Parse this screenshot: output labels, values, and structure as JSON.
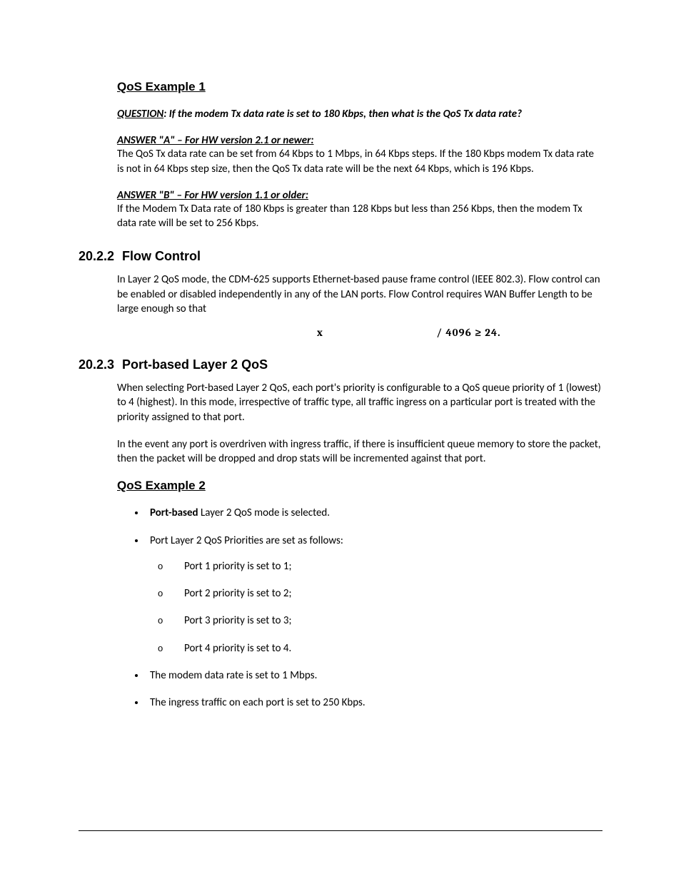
{
  "example1": {
    "title": "QoS Example 1",
    "question_label": "QUESTION",
    "question_rest": ": If the modem Tx data rate is set to 180 Kbps, then what is the QoS Tx data rate?",
    "answer_a_hdr": "ANSWER \"A\" – For HW version 2.1 or newer:",
    "answer_a_body": "The QoS Tx data rate can be set from 64 Kbps to 1 Mbps, in 64 Kbps steps. If the 180 Kbps modem Tx data rate is not in 64 Kbps step size, then the QoS Tx data rate will be the next 64 Kbps, which is 196 Kbps.",
    "answer_b_hdr": "ANSWER \"B\" – For HW version 1.1 or older:",
    "answer_b_body": "If the Modem Tx Data rate of 180 Kbps is greater than 128 Kbps but less than 256 Kbps, then the modem Tx data rate will be set to 256 Kbps."
  },
  "section_flow": {
    "num": "20.2.2",
    "title": "Flow Control",
    "body": "In Layer 2 QoS mode, the CDM-625 supports Ethernet-based pause frame control (IEEE 802.3). Flow control can be enabled or disabled independently in any of the LAN ports. Flow Control requires WAN Buffer Length to be large enough so that",
    "formula_x": "x",
    "formula_rest": "/ 4096 ≥ 24."
  },
  "section_port": {
    "num": "20.2.3",
    "title": "Port-based Layer 2 QoS",
    "p1": "When selecting Port-based Layer 2 QoS, each port's priority is configurable to a QoS queue priority of 1 (lowest) to 4 (highest). In this mode, irrespective of traffic type, all traffic ingress on a particular port is treated with the priority assigned to that port.",
    "p2": "In the event any port is overdriven with ingress traffic, if there is insufficient queue memory to store the packet, then the packet will be dropped and drop stats will be incremented against that port."
  },
  "example2": {
    "title": "QoS Example 2",
    "b1_bold": "Port-based",
    "b1_rest": " Layer 2 QoS mode is selected.",
    "b2": "Port Layer 2 QoS Priorities are set as follows:",
    "sub": [
      "Port 1 priority is set to 1;",
      "Port 2 priority is set to 2;",
      "Port 3 priority is set to 3;",
      "Port 4 priority is set to 4."
    ],
    "b3": "The modem data rate is set to 1 Mbps.",
    "b4": "The ingress traffic on each port is set to 250 Kbps."
  }
}
